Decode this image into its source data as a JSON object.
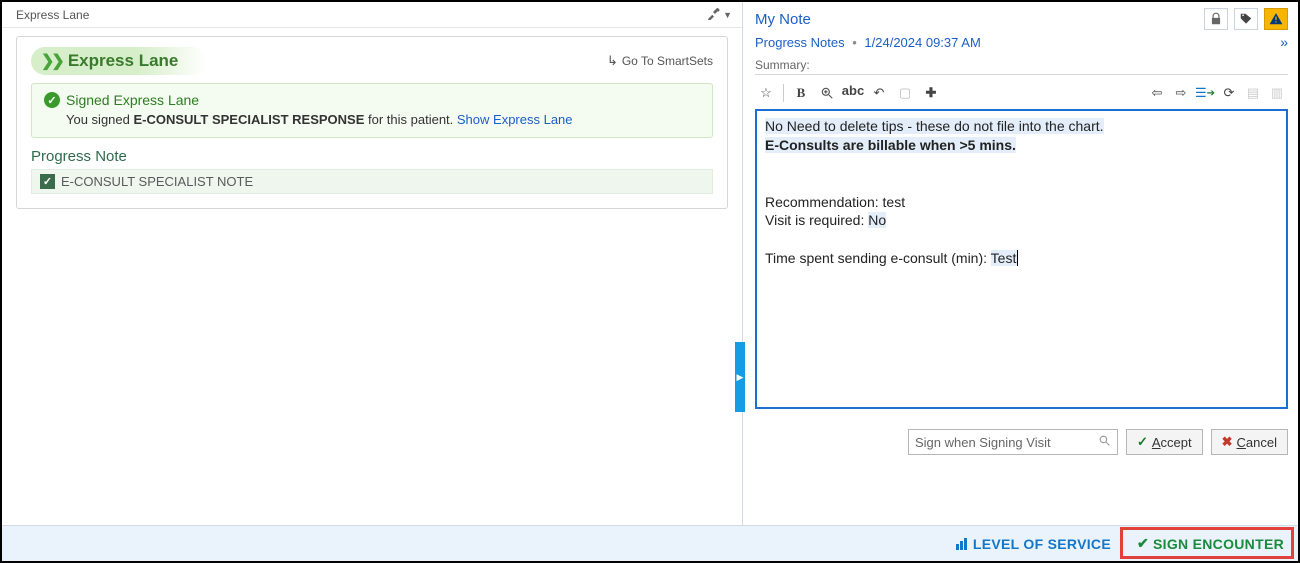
{
  "left": {
    "tab_title": "Express Lane",
    "express_heading": "Express Lane",
    "smartsets_label": "Go To SmartSets",
    "signed_title": "Signed Express Lane",
    "signed_prefix": "You signed ",
    "signed_bold": "E-CONSULT SPECIALIST RESPONSE",
    "signed_suffix": " for this patient. ",
    "signed_link": "Show Express Lane",
    "progress_heading": "Progress Note",
    "progress_item": "E-CONSULT SPECIALIST NOTE"
  },
  "right": {
    "title": "My Note",
    "subtype": "Progress Notes",
    "timestamp": "1/24/2024 09:37 AM",
    "summary_label": "Summary:",
    "editor": {
      "tip_line": " No Need to delete tips - these do not file into the chart. ",
      "billable_line": "E-Consults are billable when >5 mins.",
      "rec_label": "Recommendation: ",
      "rec_value": "test",
      "visit_label": "Visit is required: ",
      "visit_value": "No",
      "time_label": "Time spent sending e-consult (min): ",
      "time_value": "Test"
    },
    "search_placeholder": "Sign when Signing Visit",
    "accept_label": "Accept",
    "cancel_label": "Cancel"
  },
  "footer": {
    "los_label": "LEVEL OF SERVICE",
    "sign_label": "SIGN ENCOUNTER"
  }
}
